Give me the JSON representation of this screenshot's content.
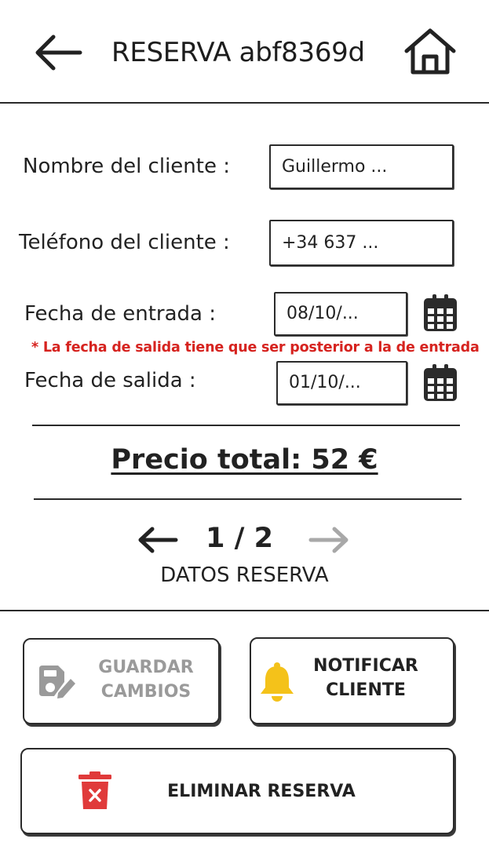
{
  "header": {
    "title": "RESERVA abf8369d",
    "back_icon": "arrow-left-icon",
    "home_icon": "home-icon"
  },
  "form": {
    "client_name": {
      "label": "Nombre del cliente :",
      "value": "Guillermo ..."
    },
    "client_phone": {
      "label": "Teléfono del cliente :",
      "value": "+34 637 ..."
    },
    "check_in": {
      "label": "Fecha de entrada :",
      "value": "08/10/..."
    },
    "check_out": {
      "label": "Fecha de salida :",
      "value": "01/10/..."
    },
    "date_error": "* La fecha de salida tiene que ser posterior a la de entrada",
    "calendar_icon": "calendar-icon"
  },
  "total": {
    "text": "Precio total: 52 €"
  },
  "pager": {
    "current": "1 / 2",
    "section": "DATOS RESERVA"
  },
  "actions": {
    "save": {
      "line1": "GUARDAR",
      "line2": "CAMBIOS",
      "icon": "save-edit-icon",
      "enabled": false
    },
    "notify": {
      "line1": "NOTIFICAR",
      "line2": "CLIENTE",
      "icon": "bell-icon"
    },
    "delete": {
      "label": "ELIMINAR RESERVA",
      "icon": "trash-icon"
    }
  },
  "colors": {
    "error": "#d6231f",
    "bell": "#f4c21a",
    "trash": "#e03a3a",
    "disabled": "#9a9a9a",
    "ink": "#222222"
  }
}
